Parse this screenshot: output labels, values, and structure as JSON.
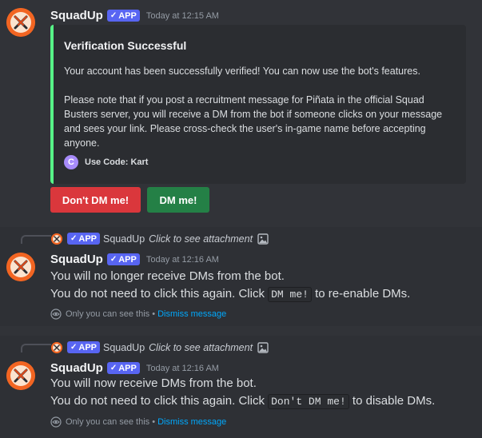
{
  "bot": {
    "name": "SquadUp",
    "badge": "APP",
    "badge_check": "✓"
  },
  "msg1": {
    "timestamp": "Today at 12:15 AM",
    "embed": {
      "accent": "#57f287",
      "title": "Verification Successful",
      "desc1": "Your account has been successfully verified! You can now use the bot's features.",
      "desc2": "Please note that if you post a recruitment message for Piñata in the official Squad Busters server, you will receive a DM from the bot if someone clicks on your message and sees your link. Please cross-check the user's in-game name before accepting anyone.",
      "footer_icon_letter": "C",
      "footer": "Use Code: Kart"
    },
    "buttons": {
      "dont_dm": "Don't DM me!",
      "dm": "DM me!"
    }
  },
  "msg2": {
    "reply": {
      "name": "SquadUp",
      "attachment": "Click to see attachment"
    },
    "timestamp": "Today at 12:16 AM",
    "line1": "You will no longer receive DMs from the bot.",
    "line2_a": "You do not need to click this again. Click",
    "line2_code": "DM me!",
    "line2_b": "to re-enable DMs.",
    "ephemeral": "Only you can see this •",
    "dismiss": "Dismiss message"
  },
  "msg3": {
    "reply": {
      "name": "SquadUp",
      "attachment": "Click to see attachment"
    },
    "timestamp": "Today at 12:16 AM",
    "line1": "You will now receive DMs from the bot.",
    "line2_a": "You do not need to click this again. Click",
    "line2_code": "Don't DM me!",
    "line2_b": "to disable DMs.",
    "ephemeral": "Only you can see this •",
    "dismiss": "Dismiss message"
  },
  "colors": {
    "background": "#313338",
    "ephemeral_bg": "#2e3035",
    "brand": "#5865f2",
    "danger": "#da373c",
    "success": "#248046",
    "link": "#00a8fc"
  }
}
